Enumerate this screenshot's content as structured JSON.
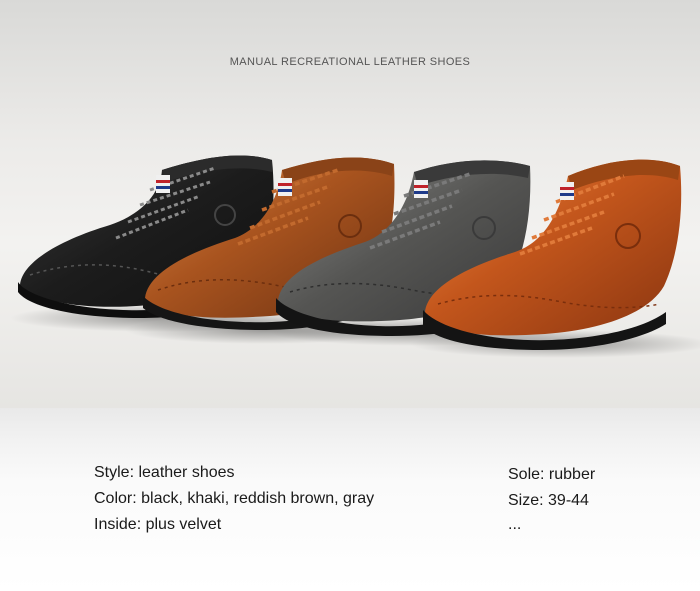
{
  "banner": {
    "title": "MANUAL RECREATIONAL LEATHER SHOES"
  },
  "product_image": {
    "subject": "four lace-up leather boots",
    "colors": [
      "#1d1d1d",
      "#a9541f",
      "#4d4d4d",
      "#c3561c"
    ]
  },
  "specs": {
    "left": [
      "Style: leather shoes",
      "Color: black, khaki, reddish brown, gray",
      "Inside: plus velvet"
    ],
    "right": [
      "Sole: rubber",
      "Size: 39-44",
      "..."
    ]
  }
}
